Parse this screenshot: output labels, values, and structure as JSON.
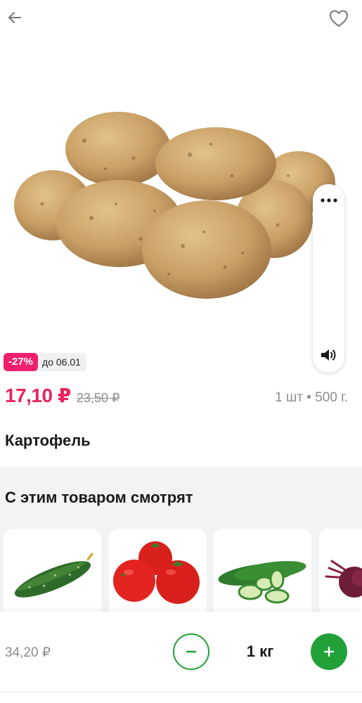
{
  "header": {
    "back_icon": "arrow-left-icon",
    "favorite_icon": "heart-outline-icon"
  },
  "product": {
    "image_icon": "potatoes-image",
    "discount": "-27%",
    "discount_until": "до 06.01",
    "price": "17,10 ₽",
    "old_price": "23,50 ₽",
    "pack": "1 шт • 500 г.",
    "name": "Картофель"
  },
  "volume_panel": {
    "more_icon": "more-horizontal-icon",
    "sound_icon": "speaker-icon"
  },
  "related": {
    "title": "С этим товаром смотрят",
    "items": [
      {
        "image": "cucumber-image"
      },
      {
        "image": "tomatoes-image"
      },
      {
        "image": "sliced-cucumber-image"
      },
      {
        "image": "beetroot-image"
      }
    ]
  },
  "cart_bar": {
    "price": "34,20 ₽",
    "quantity": "1 кг",
    "minus_icon": "minus-icon",
    "plus_icon": "plus-icon"
  },
  "colors": {
    "accent_green": "#21a038",
    "price_pink": "#e8245e",
    "badge_pink": "#f01f6e",
    "muted_gray": "#8c8c8c"
  }
}
